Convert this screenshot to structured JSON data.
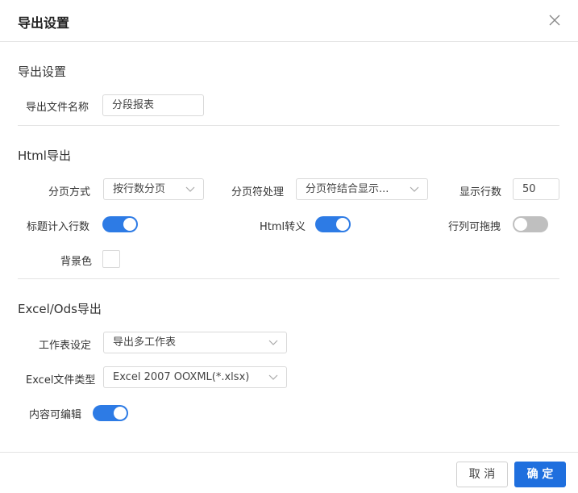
{
  "dialog": {
    "title": "导出设置"
  },
  "sections": {
    "export_settings": {
      "title": "导出设置",
      "file_name_label": "导出文件名称",
      "file_name_value": "分段报表"
    },
    "html_export": {
      "title": "Html导出",
      "paging_mode_label": "分页方式",
      "paging_mode_value": "按行数分页",
      "page_break_label": "分页符处理",
      "page_break_value": "分页符结合显示...",
      "rows_shown_label": "显示行数",
      "rows_shown_value": "50",
      "title_count_label": "标题计入行数",
      "title_count_on": true,
      "html_escape_label": "Html转义",
      "html_escape_on": true,
      "draggable_label": "行列可拖拽",
      "draggable_on": false,
      "bg_color_label": "背景色",
      "bg_color_value": "#ffffff"
    },
    "excel_export": {
      "title": "Excel/Ods导出",
      "sheet_label": "工作表设定",
      "sheet_value": "导出多工作表",
      "file_type_label": "Excel文件类型",
      "file_type_value": "Excel 2007 OOXML(*.xlsx)",
      "editable_label": "内容可编辑",
      "editable_on": true
    }
  },
  "footer": {
    "cancel_label": "取 消",
    "ok_label": "确 定"
  },
  "colors": {
    "accent": "#2d7be5",
    "switch_off": "#bfbfbf",
    "primary_button": "#1f6fde"
  },
  "icons": {
    "close": "close-icon",
    "dropdown": "chevron-down-icon"
  }
}
